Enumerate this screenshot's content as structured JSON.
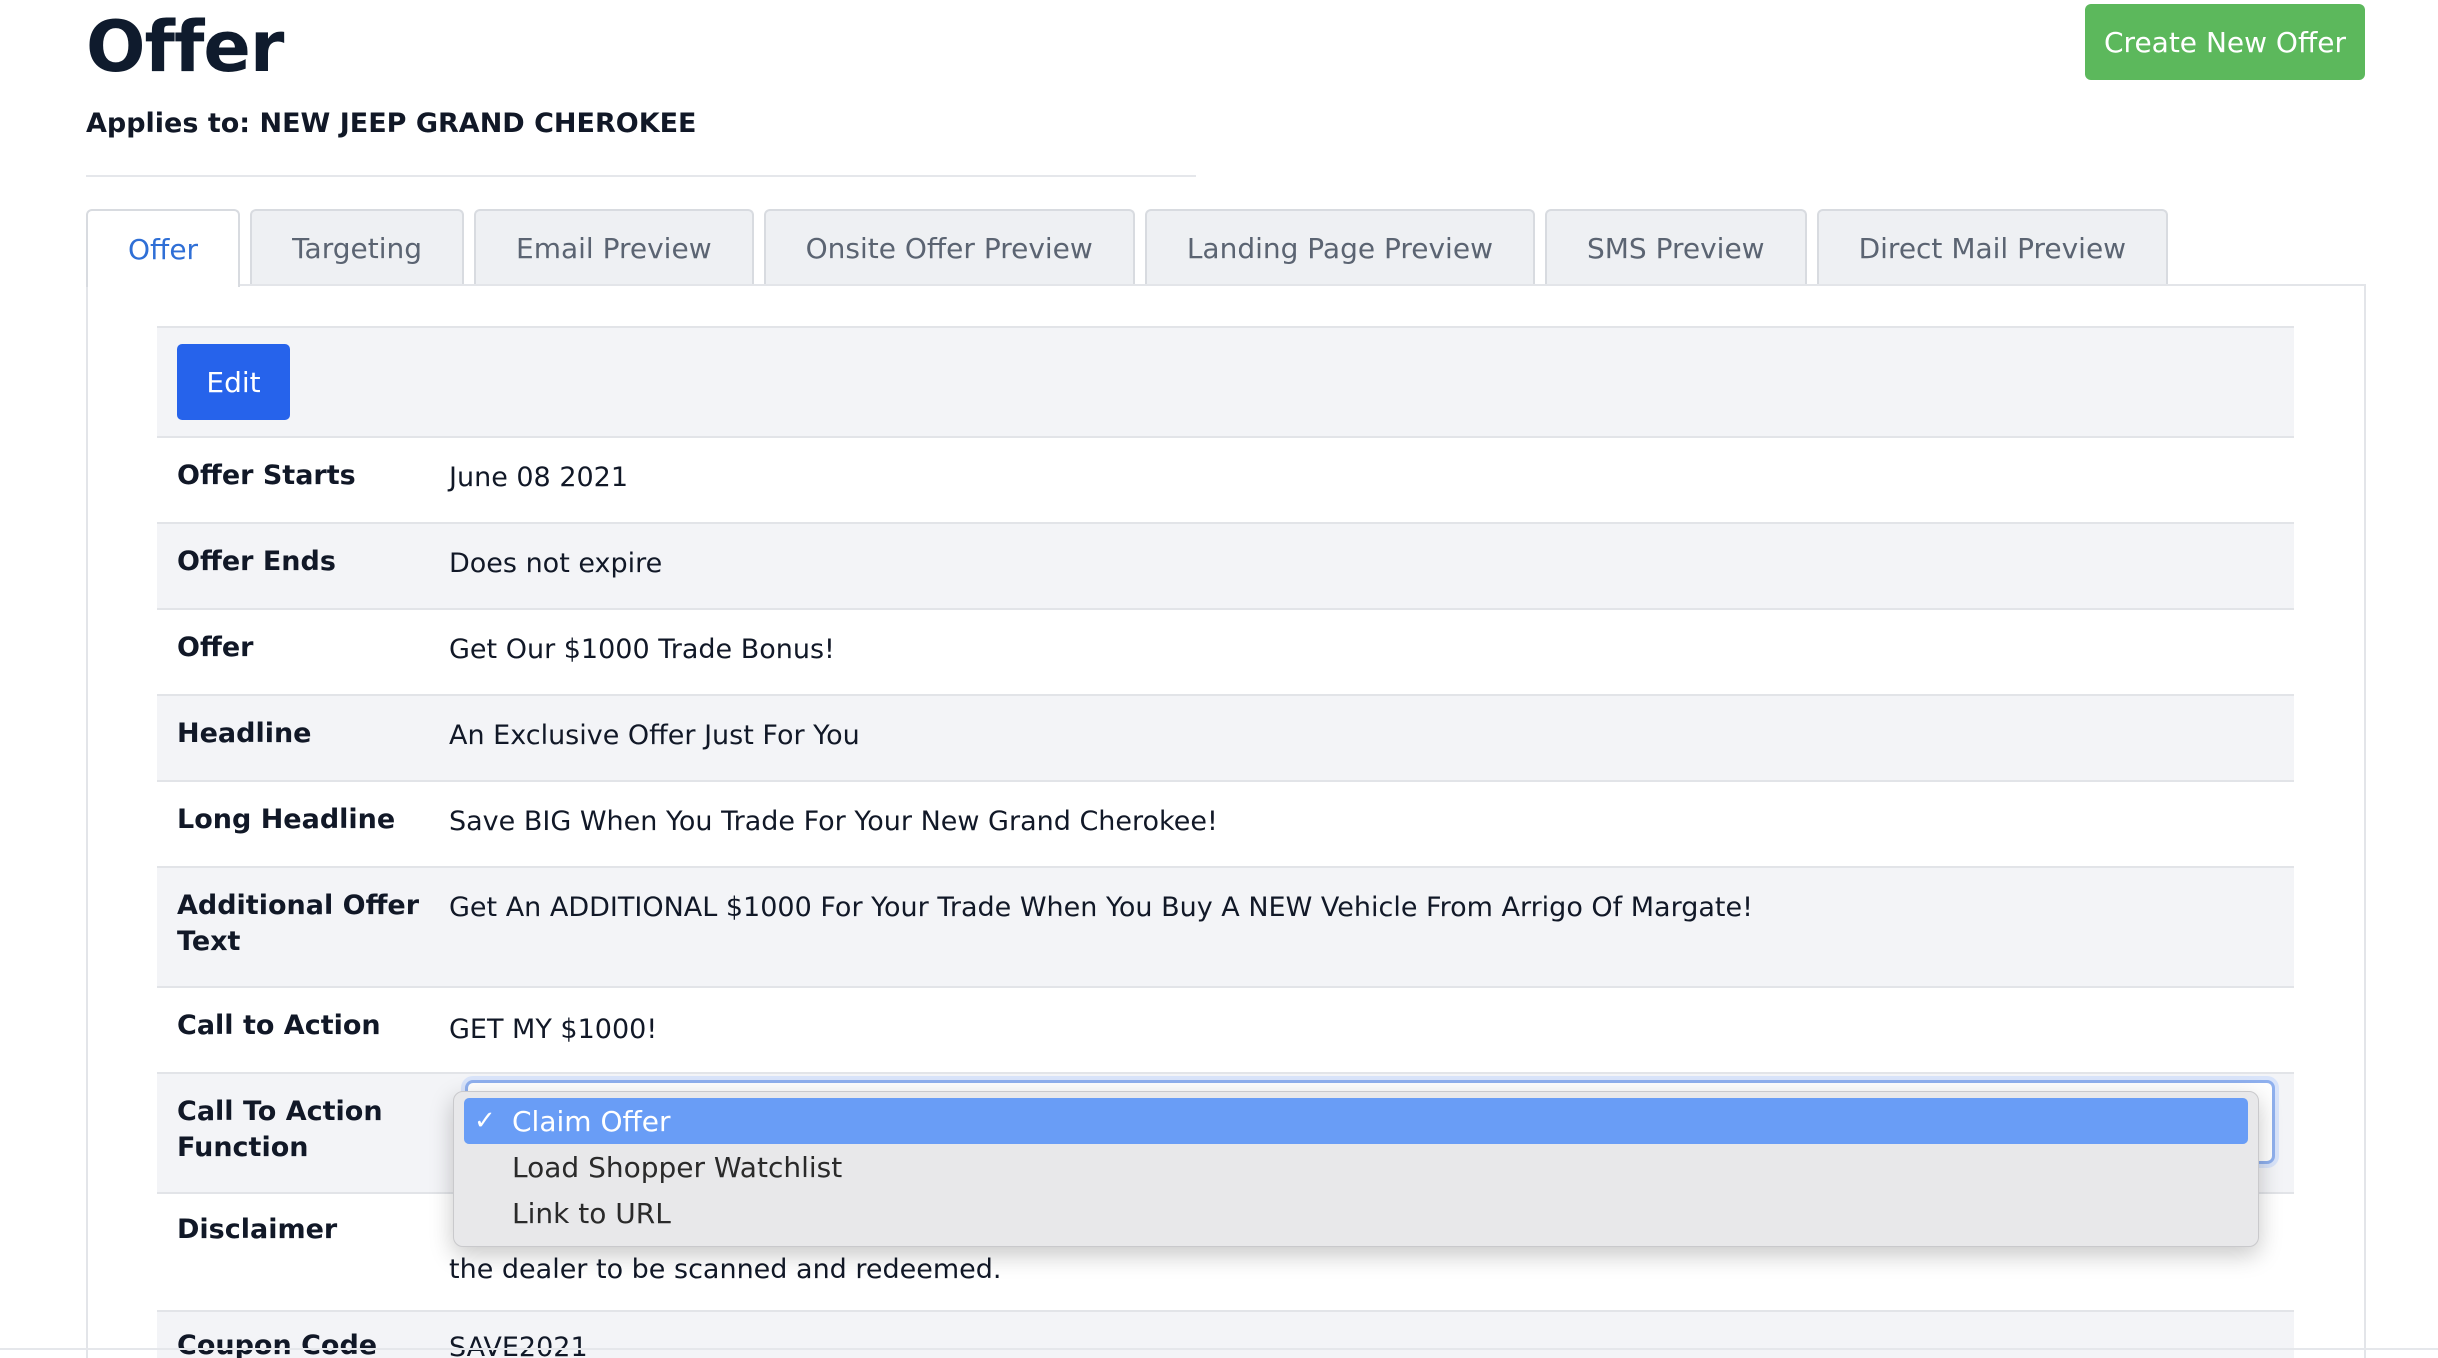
{
  "header": {
    "title": "Offer",
    "applies_to": "Applies to: NEW JEEP GRAND CHEROKEE",
    "create_button": "Create New Offer"
  },
  "tabs": [
    {
      "label": "Offer",
      "active": true
    },
    {
      "label": "Targeting"
    },
    {
      "label": "Email Preview"
    },
    {
      "label": "Onsite Offer Preview"
    },
    {
      "label": "Landing Page Preview"
    },
    {
      "label": "SMS Preview"
    },
    {
      "label": "Direct Mail Preview"
    }
  ],
  "edit_button": "Edit",
  "fields": [
    {
      "label": "Offer Starts",
      "value": "June 08 2021"
    },
    {
      "label": "Offer Ends",
      "value": "Does not expire"
    },
    {
      "label": "Offer",
      "value": "Get Our $1000 Trade Bonus!"
    },
    {
      "label": "Headline",
      "value": "An Exclusive Offer Just For You"
    },
    {
      "label": "Long Headline",
      "value": "Save BIG When You Trade For Your New Grand Cherokee!"
    },
    {
      "label": "Additional Offer Text",
      "value": "Get An ADDITIONAL $1000 For Your Trade When You Buy A NEW Vehicle From Arrigo Of Margate!"
    },
    {
      "label": "Call to Action",
      "value": "GET MY $1000!"
    },
    {
      "label": "Call To Action Function",
      "value": ""
    },
    {
      "label": "Disclaimer",
      "value": "the dealer to be scanned and redeemed."
    },
    {
      "label": "Coupon Code",
      "value": "SAVE2021"
    }
  ],
  "dropdown": {
    "check": "✓",
    "options": [
      "Claim Offer",
      "Load Shopper Watchlist",
      "Link to URL"
    ],
    "selected": "Claim Offer"
  }
}
